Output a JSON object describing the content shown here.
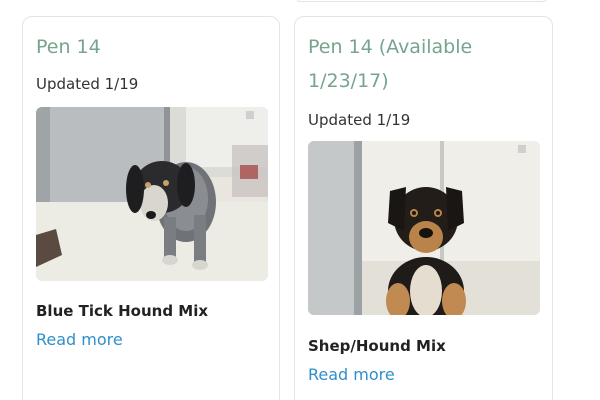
{
  "cards": [
    {
      "title": "Pen 14",
      "updated": "Updated 1/19",
      "photo_icon": "dog-photo",
      "breed": "Blue Tick Hound Mix",
      "link": "Read more"
    },
    {
      "title": "Pen 14 (Available 1/23/17)",
      "updated": "Updated 1/19",
      "photo_icon": "dog-photo",
      "breed": "Shep/Hound Mix",
      "link": "Read more"
    }
  ],
  "colors": {
    "title": "#76a48d",
    "link": "#2f8fc8",
    "text": "#333333",
    "border": "#e4e4e4"
  }
}
